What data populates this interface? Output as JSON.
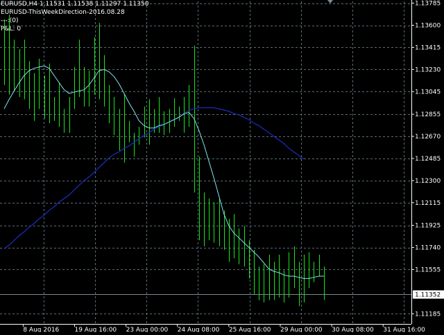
{
  "header": {
    "line1": "EURUSD,H4  1.11531 1.11538 1.11297 1.11350",
    "line2": "EURUSD-ThisWeekDirection-2016.08.28",
    "line3": "---:(0)",
    "line4": "P&L: 0"
  },
  "colors": {
    "background": "#000000",
    "bar": "#19e619",
    "grid": "#5a6e78",
    "axis": "#ffffff",
    "fast_ma": "#7fe8f0",
    "slow_ma": "#1c2ab8",
    "price_line": "#7a8a96",
    "price_box_bg": "#ffffff",
    "price_box_text": "#000000"
  },
  "chart_data": {
    "type": "ohlc",
    "symbol": "EURUSD",
    "timeframe": "H4",
    "ylim": [
      1.111,
      1.138
    ],
    "y_ticks": [
      "1.13785",
      "1.13600",
      "1.13415",
      "1.13230",
      "1.13045",
      "1.12855",
      "1.12670",
      "1.12485",
      "1.12300",
      "1.12115",
      "1.11925",
      "1.11740",
      "1.11555",
      "1.11352",
      "1.11185"
    ],
    "current_price": "1.11352",
    "x_tick_labels": [
      "8 Aug 2016",
      "19 Aug 16:00",
      "23 Aug 00:00",
      "24 Aug 08:00",
      "25 Aug 16:00",
      "29 Aug 00:00",
      "30 Aug 08:00",
      "31 Aug 16:00"
    ],
    "bar_highs": [
      1.1365,
      1.1369,
      1.1348,
      1.134,
      1.1348,
      1.133,
      1.132,
      1.1332,
      1.1318,
      1.1328,
      1.13,
      1.1312,
      1.129,
      1.13,
      1.1325,
      1.1348,
      1.1325,
      1.1322,
      1.135,
      1.1362,
      1.1335,
      1.131,
      1.13,
      1.129,
      1.1302,
      1.128,
      1.127,
      1.1275,
      1.1292,
      1.1298,
      1.129,
      1.13,
      1.1288,
      1.129,
      1.1299,
      1.1292,
      1.13,
      1.131,
      1.1343,
      1.125,
      1.122,
      1.1215,
      1.1212,
      1.1215,
      1.1205,
      1.1198,
      1.1202,
      1.119,
      1.1192,
      1.118,
      1.1172,
      1.1158,
      1.116,
      1.1168,
      1.1162,
      1.1168,
      1.1155,
      1.117,
      1.1175,
      1.1162,
      1.1168,
      1.117,
      1.1162,
      1.1168,
      1.1158
    ],
    "bar_lows": [
      1.131,
      1.1302,
      1.1305,
      1.13,
      1.1298,
      1.129,
      1.128,
      1.129,
      1.1282,
      1.1278,
      1.128,
      1.1275,
      1.127,
      1.127,
      1.129,
      1.13,
      1.1292,
      1.1292,
      1.1302,
      1.1298,
      1.1292,
      1.1278,
      1.1268,
      1.1255,
      1.1245,
      1.1262,
      1.125,
      1.126,
      1.1266,
      1.126,
      1.127,
      1.127,
      1.1268,
      1.127,
      1.1275,
      1.128,
      1.127,
      1.1275,
      1.122,
      1.118,
      1.1175,
      1.118,
      1.1178,
      1.1175,
      1.1172,
      1.1162,
      1.1165,
      1.116,
      1.1158,
      1.1148,
      1.1135,
      1.113,
      1.1128,
      1.113,
      1.113,
      1.1132,
      1.1128,
      1.1132,
      1.114,
      1.1125,
      1.1128,
      1.114,
      1.1145,
      1.115,
      1.113
    ],
    "fast_ma": [
      1.129,
      1.1298,
      1.1305,
      1.1312,
      1.1318,
      1.1322,
      1.1324,
      1.1325,
      1.1326,
      1.1324,
      1.1318,
      1.1312,
      1.1306,
      1.1303,
      1.1304,
      1.1305,
      1.1306,
      1.131,
      1.1316,
      1.1322,
      1.1323,
      1.1321,
      1.1317,
      1.1311,
      1.1303,
      1.1295,
      1.1288,
      1.128,
      1.1276,
      1.1274,
      1.1274,
      1.1276,
      1.1277,
      1.1279,
      1.1281,
      1.1283,
      1.1286,
      1.1287,
      1.1282,
      1.1272,
      1.126,
      1.1246,
      1.1232,
      1.1217,
      1.1202,
      1.1192,
      1.1186,
      1.1182,
      1.1178,
      1.1174,
      1.117,
      1.1166,
      1.1161,
      1.1156,
      1.1154,
      1.1153,
      1.1151,
      1.115,
      1.115,
      1.1149,
      1.1148,
      1.1148,
      1.1149,
      1.115,
      1.115
    ],
    "slow_ma": [
      1.1173,
      1.1176,
      1.118,
      1.1184,
      1.1187,
      1.1191,
      1.1194,
      1.1198,
      1.1201,
      1.1205,
      1.1208,
      1.1212,
      1.1215,
      1.1218,
      1.1222,
      1.1226,
      1.123,
      1.1233,
      1.1237,
      1.1241,
      1.1245,
      1.1249,
      1.1252,
      1.1254,
      1.1257,
      1.1259,
      1.1262,
      1.1265,
      1.1268,
      1.127,
      1.1273,
      1.1275,
      1.1277,
      1.1279,
      1.1281,
      1.1283,
      1.1286,
      1.1289,
      1.129,
      1.1291,
      1.1291,
      1.1291,
      1.1291,
      1.129,
      1.1289,
      1.1288,
      1.1286,
      1.1285,
      1.1283,
      1.1281,
      1.1278,
      1.1276,
      1.1273,
      1.127,
      1.1267,
      1.1264,
      1.1261,
      1.1257,
      1.1254,
      1.1251,
      1.1248
    ]
  }
}
